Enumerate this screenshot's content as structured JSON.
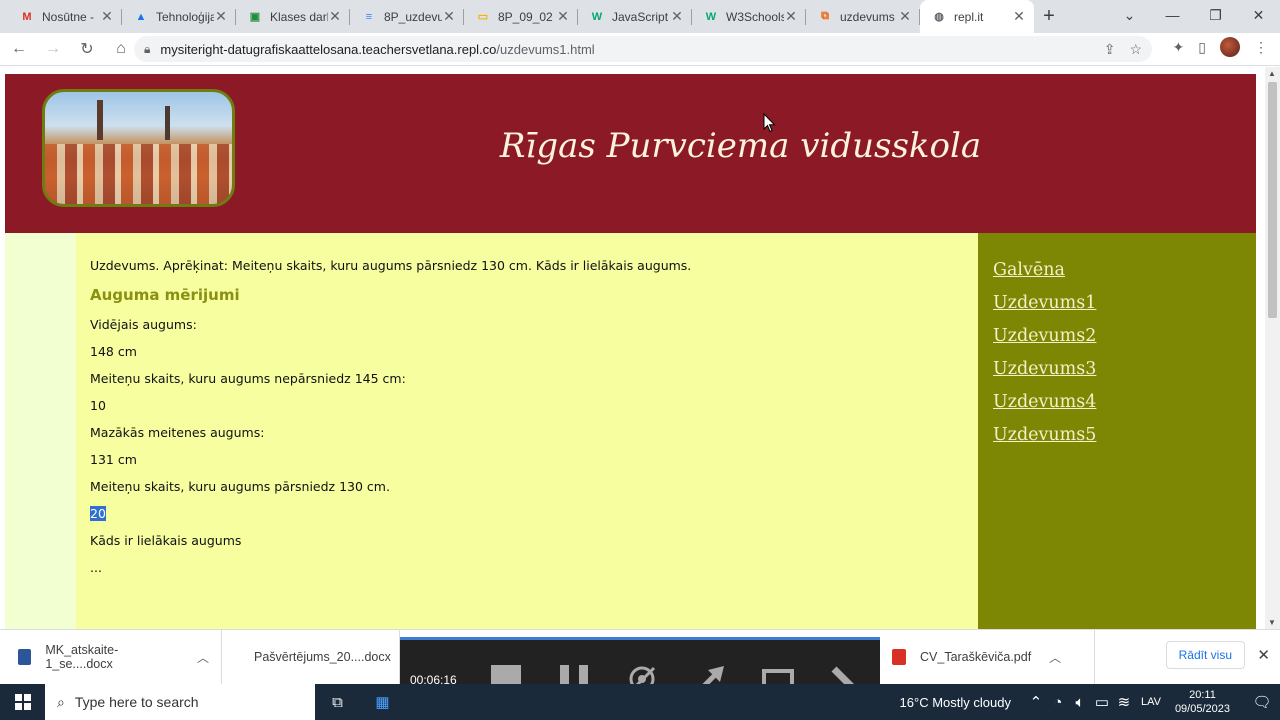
{
  "tabs": [
    {
      "title": "Nosūtne -",
      "icon": "gmail-icon",
      "color": "#d93025",
      "glyph": "M"
    },
    {
      "title": "Tehnoloģijas",
      "icon": "drive-icon",
      "color": "#1a73e8",
      "glyph": "▲"
    },
    {
      "title": "Klases darb",
      "icon": "classroom-icon",
      "color": "#1e8e3e",
      "glyph": "▣"
    },
    {
      "title": "8P_uzdevu",
      "icon": "docs-icon",
      "color": "#4285f4",
      "glyph": "≡"
    },
    {
      "title": "8P_09_02",
      "icon": "slides-icon",
      "color": "#f4b400",
      "glyph": "▭"
    },
    {
      "title": "JavaScript",
      "icon": "w3schools-icon",
      "color": "#04aa6d",
      "glyph": "W"
    },
    {
      "title": "W3Schools",
      "icon": "w3schools-icon",
      "color": "#04aa6d",
      "glyph": "W"
    },
    {
      "title": "uzdevums",
      "icon": "replit-icon",
      "color": "#f26207",
      "glyph": "⧉"
    },
    {
      "title": "repl.it",
      "icon": "globe-icon",
      "color": "#5f6368",
      "glyph": "◍",
      "active": true
    }
  ],
  "url": {
    "host": "mysiteright-datugrafiskaattelosana.teachersvetlana.repl.co",
    "path": "/uzdevums1.html"
  },
  "site": {
    "title": "Rīgas Purvciema vidusskola"
  },
  "main": {
    "task": "Uzdevums. Aprēķinat: Meiteņu skaits, kuru augums pārsniedz 130 cm. Kāds ir lielākais augums.",
    "heading": "Auguma mērijumi",
    "lines": [
      "Vidējais augums:",
      "148 cm",
      "Meiteņu skaits, kuru augums nepārsniedz 145 cm:",
      "10",
      "Mazākās meitenes augums:",
      "131 cm",
      "Meiteņu skaits, kuru augums pārsniedz 130 cm."
    ],
    "selected": "20",
    "after": [
      "Kāds ir lielākais augums",
      "..."
    ]
  },
  "nav": [
    "Galvēna",
    "Uzdevums1",
    "Uzdevums2",
    "Uzdevums3",
    "Uzdevums4",
    "Uzdevums5"
  ],
  "downloads": [
    {
      "name": "MK_atskaite-1_se....docx",
      "color": "#2b579a"
    },
    {
      "name": "Pašvērtējums_20....docx",
      "color": "#2b579a"
    },
    {
      "name": "CV_Taraškēviča.pdf",
      "color": "#d93025"
    }
  ],
  "downloads_show_all": "Rādīt visu",
  "recording": {
    "timer": "00:06:16"
  },
  "taskbar": {
    "search_placeholder": "Type here to search",
    "weather": "16°C  Mostly cloudy",
    "lang": "LAV",
    "time": "20:11",
    "date": "09/05/2023"
  },
  "colors": {
    "header_bg": "#8b1a26",
    "main_bg": "#f6fea0",
    "sidebar_bg": "#7d8704",
    "heading": "#8a9012"
  }
}
